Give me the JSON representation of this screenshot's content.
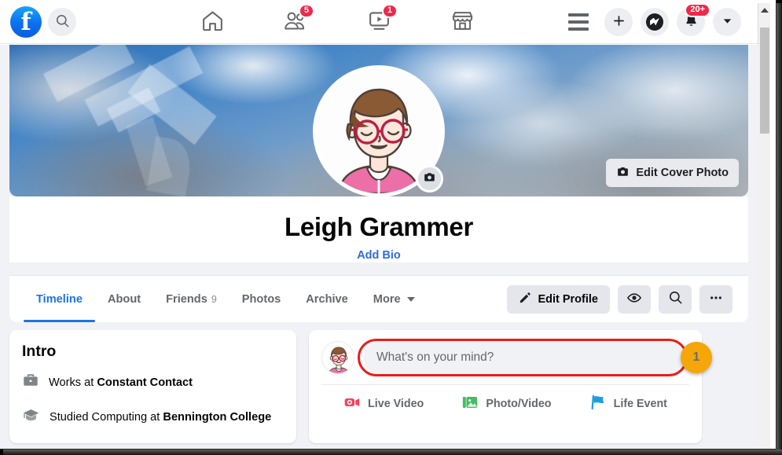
{
  "topbar": {
    "logo": "facebook-logo",
    "search_icon": "search-icon",
    "nav_tabs": [
      {
        "name": "home",
        "icon": "home-icon",
        "badge": ""
      },
      {
        "name": "friends",
        "icon": "friends-icon",
        "badge": "5"
      },
      {
        "name": "watch",
        "icon": "watch-video-icon",
        "badge": "1"
      },
      {
        "name": "marketplace",
        "icon": "marketplace-icon",
        "badge": ""
      }
    ],
    "menu_icon": "hamburger-menu-icon",
    "create_icon": "plus-icon",
    "messenger_icon": "messenger-icon",
    "notifications_icon": "bell-icon",
    "notifications_badge": "20+",
    "account_icon": "chevron-down-icon"
  },
  "cover": {
    "edit_label": "Edit Cover Photo",
    "edit_icon": "camera-icon",
    "photo_alt": "cloudy-blue-sky-cover-photo"
  },
  "profile": {
    "name": "Leigh Grammer",
    "bio_link": "Add Bio",
    "avatar_alt": "cartoon-woman-glasses-pink-top",
    "avatar_camera_icon": "camera-icon"
  },
  "tabs": [
    {
      "label": "Timeline",
      "count": "",
      "active": true,
      "caret": false
    },
    {
      "label": "About",
      "count": "",
      "active": false,
      "caret": false
    },
    {
      "label": "Friends",
      "count": "9",
      "active": false,
      "caret": false
    },
    {
      "label": "Photos",
      "count": "",
      "active": false,
      "caret": false
    },
    {
      "label": "Archive",
      "count": "",
      "active": false,
      "caret": false
    },
    {
      "label": "More",
      "count": "",
      "active": false,
      "caret": true
    }
  ],
  "tab_actions": {
    "edit_profile_label": "Edit Profile",
    "edit_profile_icon": "pencil-icon",
    "view_as_icon": "eye-icon",
    "search_icon": "search-icon",
    "more_icon": "ellipsis-icon"
  },
  "intro": {
    "title": "Intro",
    "rows": [
      {
        "icon": "briefcase-icon",
        "prefix": "Works at ",
        "value": "Constant Contact"
      },
      {
        "icon": "graduation-cap-icon",
        "prefix": "Studied Computing at ",
        "value": "Bennington College"
      }
    ]
  },
  "composer": {
    "placeholder": "What's on your mind?",
    "avatar_alt": "cartoon-woman-glasses-pink-top",
    "actions": [
      {
        "label": "Live Video",
        "icon": "live-video-icon",
        "color": "#f3425f"
      },
      {
        "label": "Photo/Video",
        "icon": "photo-video-icon",
        "color": "#45bd62"
      },
      {
        "label": "Life Event",
        "icon": "life-event-icon",
        "color": "#1b9ee0"
      }
    ]
  },
  "annotation": {
    "marker_number": "1",
    "ring_color": "#ee1b1b",
    "badge_color": "#f5a608",
    "target": "composer-input"
  },
  "scrollbar": {
    "up_arrow_icon": "scroll-up-arrow-icon"
  }
}
